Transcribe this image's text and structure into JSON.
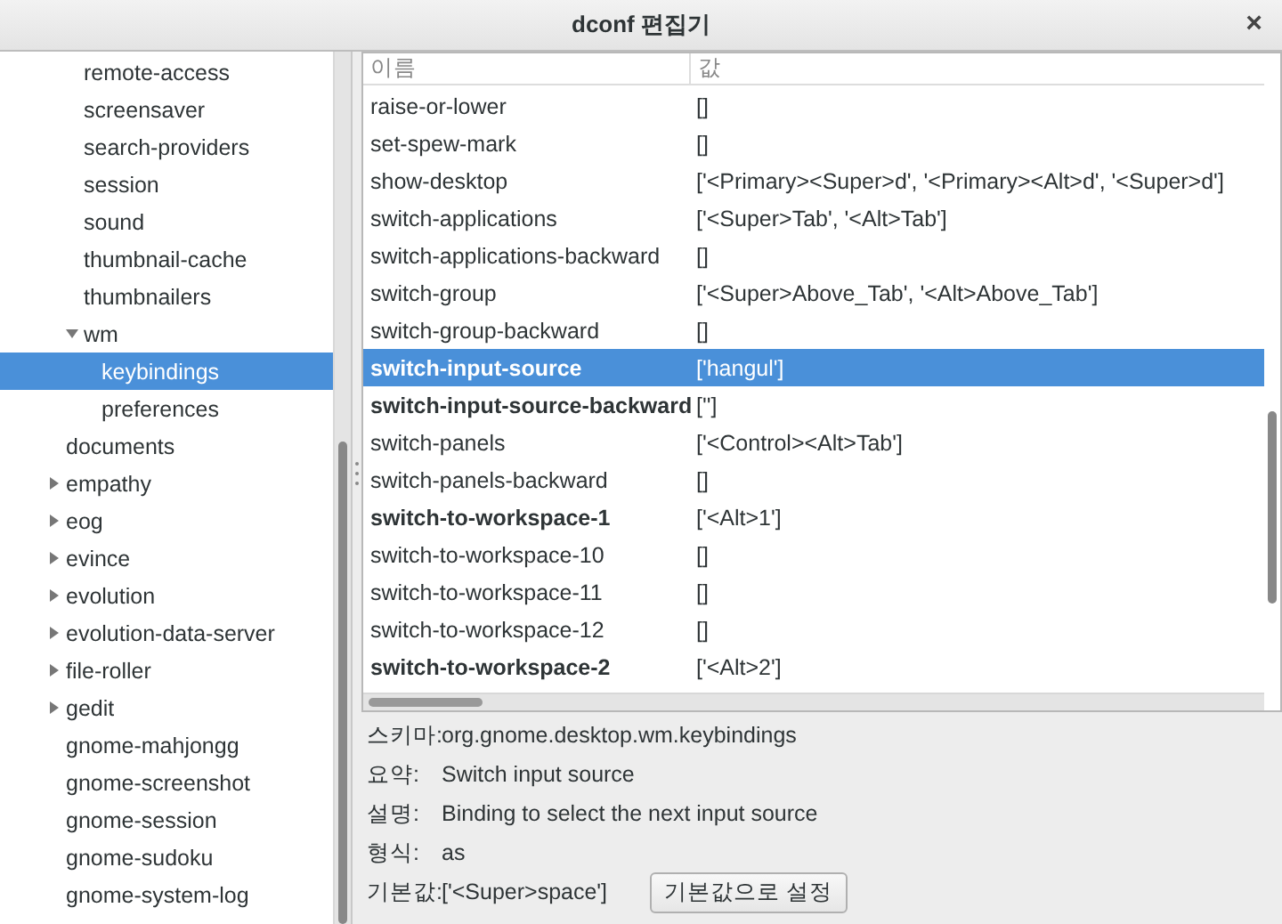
{
  "window": {
    "title": "dconf 편집기",
    "close": "×"
  },
  "tree": [
    {
      "children": [
        {
          "label": "remote-access",
          "selected": false
        },
        {
          "label": "screensaver",
          "selected": false
        },
        {
          "label": "search-providers",
          "selected": false
        },
        {
          "label": "session",
          "selected": false
        },
        {
          "label": "sound",
          "selected": false
        },
        {
          "label": "thumbnail-cache",
          "selected": false
        },
        {
          "label": "thumbnailers",
          "selected": false
        },
        {
          "label": "wm",
          "selected": false,
          "expanded": true,
          "children": [
            {
              "label": "keybindings",
              "selected": true
            },
            {
              "label": "preferences",
              "selected": false
            }
          ]
        }
      ]
    },
    {
      "label": "documents",
      "selected": false
    },
    {
      "label": "empathy",
      "selected": false,
      "expanded": false
    },
    {
      "label": "eog",
      "selected": false,
      "expanded": false
    },
    {
      "label": "evince",
      "selected": false,
      "expanded": false
    },
    {
      "label": "evolution",
      "selected": false,
      "expanded": false
    },
    {
      "label": "evolution-data-server",
      "selected": false,
      "expanded": false
    },
    {
      "label": "file-roller",
      "selected": false,
      "expanded": false
    },
    {
      "label": "gedit",
      "selected": false,
      "expanded": false
    },
    {
      "label": "gnome-mahjongg",
      "selected": false
    },
    {
      "label": "gnome-screenshot",
      "selected": false
    },
    {
      "label": "gnome-session",
      "selected": false
    },
    {
      "label": "gnome-sudoku",
      "selected": false
    },
    {
      "label": "gnome-system-log",
      "selected": false
    }
  ],
  "table": {
    "columns": [
      "이름",
      "값"
    ],
    "rows": [
      {
        "name": "raise-or-lower",
        "value": "[]",
        "modified": false,
        "selected": false
      },
      {
        "name": "set-spew-mark",
        "value": "[]",
        "modified": false,
        "selected": false
      },
      {
        "name": "show-desktop",
        "value": "['<Primary><Super>d', '<Primary><Alt>d', '<Super>d']",
        "modified": false,
        "selected": false
      },
      {
        "name": "switch-applications",
        "value": "['<Super>Tab', '<Alt>Tab']",
        "modified": false,
        "selected": false
      },
      {
        "name": "switch-applications-backward",
        "value": "[]",
        "modified": false,
        "selected": false
      },
      {
        "name": "switch-group",
        "value": "['<Super>Above_Tab', '<Alt>Above_Tab']",
        "modified": false,
        "selected": false
      },
      {
        "name": "switch-group-backward",
        "value": "[]",
        "modified": false,
        "selected": false
      },
      {
        "name": "switch-input-source",
        "value": "['hangul']",
        "modified": true,
        "selected": true
      },
      {
        "name": "switch-input-source-backward",
        "value": "['']",
        "modified": true,
        "selected": false
      },
      {
        "name": "switch-panels",
        "value": "['<Control><Alt>Tab']",
        "modified": false,
        "selected": false
      },
      {
        "name": "switch-panels-backward",
        "value": "[]",
        "modified": false,
        "selected": false
      },
      {
        "name": "switch-to-workspace-1",
        "value": "['<Alt>1']",
        "modified": true,
        "selected": false
      },
      {
        "name": "switch-to-workspace-10",
        "value": "[]",
        "modified": false,
        "selected": false
      },
      {
        "name": "switch-to-workspace-11",
        "value": "[]",
        "modified": false,
        "selected": false
      },
      {
        "name": "switch-to-workspace-12",
        "value": "[]",
        "modified": false,
        "selected": false
      },
      {
        "name": "switch-to-workspace-2",
        "value": "['<Alt>2']",
        "modified": true,
        "selected": false
      }
    ]
  },
  "details": [
    {
      "label": "스키마:",
      "value": "org.gnome.desktop.wm.keybindings"
    },
    {
      "label": "요약:",
      "value": "Switch input source"
    },
    {
      "label": "설명:",
      "value": "Binding to select the next input source"
    },
    {
      "label": "형식:",
      "value": "as"
    },
    {
      "label": "기본값:",
      "value": "['<Super>space']",
      "button": "기본값으로 설정"
    }
  ]
}
